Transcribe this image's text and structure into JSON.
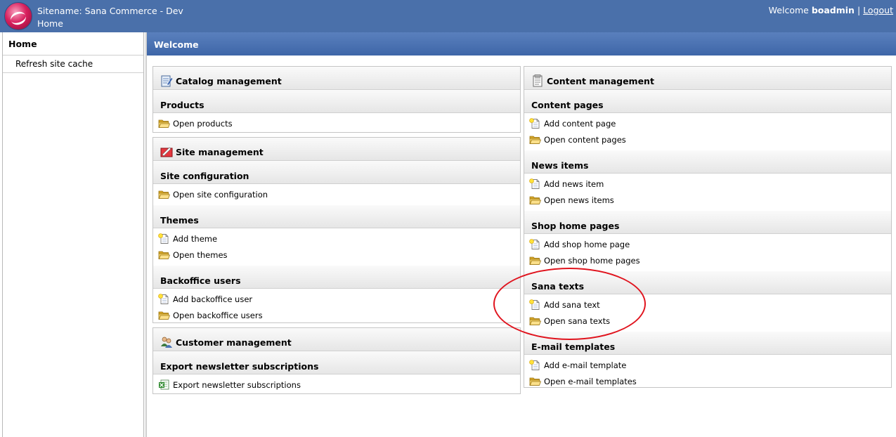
{
  "header": {
    "site_title": "Sitename: Sana Commerce - Dev",
    "crumb": "Home",
    "welcome_prefix": "Welcome",
    "username": "boadmin",
    "separator": "|",
    "logout": "Logout"
  },
  "sidebar": {
    "heading": "Home",
    "items": [
      {
        "label": "Refresh site cache"
      }
    ]
  },
  "main": {
    "title": "Welcome",
    "left": {
      "catalog": {
        "group": "Catalog management",
        "sections": [
          {
            "title": "Products",
            "items": [
              {
                "label": "Open products",
                "icon": "folder-icon"
              }
            ]
          }
        ]
      },
      "site": {
        "group": "Site management",
        "sections": [
          {
            "title": "Site configuration",
            "items": [
              {
                "label": "Open site configuration",
                "icon": "folder-icon"
              }
            ]
          },
          {
            "title": "Themes",
            "items": [
              {
                "label": "Add theme",
                "icon": "new-document-icon"
              },
              {
                "label": "Open themes",
                "icon": "folder-icon"
              }
            ]
          },
          {
            "title": "Backoffice users",
            "items": [
              {
                "label": "Add backoffice user",
                "icon": "new-document-icon"
              },
              {
                "label": "Open backoffice users",
                "icon": "folder-icon"
              }
            ]
          }
        ]
      },
      "customer": {
        "group": "Customer management",
        "sections": [
          {
            "title": "Export newsletter subscriptions",
            "items": [
              {
                "label": "Export newsletter subscriptions",
                "icon": "excel-icon"
              }
            ]
          }
        ]
      }
    },
    "right": {
      "content": {
        "group": "Content management",
        "sections": [
          {
            "title": "Content pages",
            "items": [
              {
                "label": "Add content page",
                "icon": "new-document-icon"
              },
              {
                "label": "Open content pages",
                "icon": "folder-icon"
              }
            ]
          },
          {
            "title": "News items",
            "items": [
              {
                "label": "Add news item",
                "icon": "new-document-icon"
              },
              {
                "label": "Open news items",
                "icon": "folder-icon"
              }
            ]
          },
          {
            "title": "Shop home pages",
            "items": [
              {
                "label": "Add shop home page",
                "icon": "new-document-icon"
              },
              {
                "label": "Open shop home pages",
                "icon": "folder-icon"
              }
            ]
          },
          {
            "title": "Sana texts",
            "items": [
              {
                "label": "Add sana text",
                "icon": "new-document-icon"
              },
              {
                "label": "Open sana texts",
                "icon": "folder-icon"
              }
            ]
          },
          {
            "title": "E-mail templates",
            "items": [
              {
                "label": "Add e-mail template",
                "icon": "new-document-icon"
              },
              {
                "label": "Open e-mail templates",
                "icon": "folder-icon"
              }
            ]
          }
        ]
      }
    }
  },
  "colors": {
    "header_bg": "#4a70aa",
    "annotation": "#e0141e"
  }
}
